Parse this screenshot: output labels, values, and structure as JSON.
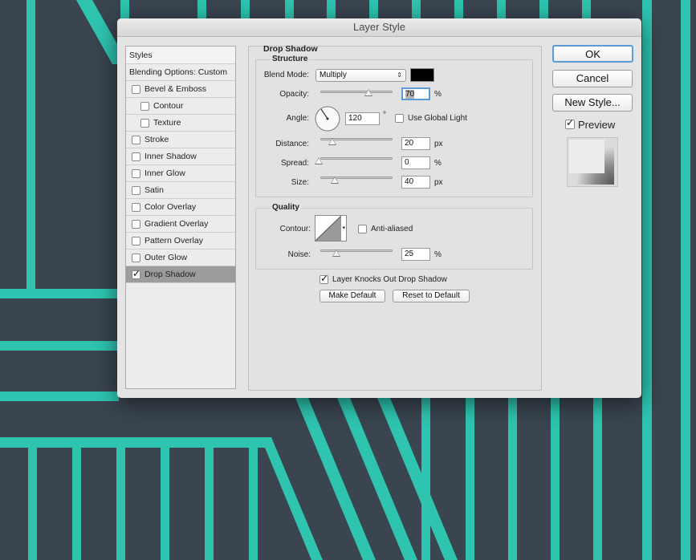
{
  "dialog": {
    "title": "Layer Style"
  },
  "styles_panel": {
    "header": "Styles",
    "blending_options": "Blending Options: Custom",
    "items": [
      {
        "label": "Bevel & Emboss",
        "checked": false,
        "sub": false
      },
      {
        "label": "Contour",
        "checked": false,
        "sub": true
      },
      {
        "label": "Texture",
        "checked": false,
        "sub": true
      },
      {
        "label": "Stroke",
        "checked": false,
        "sub": false
      },
      {
        "label": "Inner Shadow",
        "checked": false,
        "sub": false
      },
      {
        "label": "Inner Glow",
        "checked": false,
        "sub": false
      },
      {
        "label": "Satin",
        "checked": false,
        "sub": false
      },
      {
        "label": "Color Overlay",
        "checked": false,
        "sub": false
      },
      {
        "label": "Gradient Overlay",
        "checked": false,
        "sub": false
      },
      {
        "label": "Pattern Overlay",
        "checked": false,
        "sub": false
      },
      {
        "label": "Outer Glow",
        "checked": false,
        "sub": false
      },
      {
        "label": "Drop Shadow",
        "checked": true,
        "sub": false,
        "selected": true
      }
    ]
  },
  "drop_shadow": {
    "title": "Drop Shadow",
    "structure": {
      "title": "Structure",
      "blend_mode_label": "Blend Mode:",
      "blend_mode_value": "Multiply",
      "shadow_color": "#000000",
      "opacity_label": "Opacity:",
      "opacity_value": "70",
      "opacity_unit": "%",
      "angle_label": "Angle:",
      "angle_value": "120",
      "angle_unit": "°",
      "use_global_light_label": "Use Global Light",
      "use_global_light_checked": false,
      "distance_label": "Distance:",
      "distance_value": "20",
      "distance_unit": "px",
      "spread_label": "Spread:",
      "spread_value": "0",
      "spread_unit": "%",
      "size_label": "Size:",
      "size_value": "40",
      "size_unit": "px"
    },
    "quality": {
      "title": "Quality",
      "contour_label": "Contour:",
      "anti_aliased_label": "Anti-aliased",
      "anti_aliased_checked": false,
      "noise_label": "Noise:",
      "noise_value": "25",
      "noise_unit": "%"
    },
    "layer_knocks_out_label": "Layer Knocks Out Drop Shadow",
    "layer_knocks_out_checked": true,
    "make_default_label": "Make Default",
    "reset_default_label": "Reset to Default"
  },
  "actions": {
    "ok_label": "OK",
    "cancel_label": "Cancel",
    "new_style_label": "New Style...",
    "preview_label": "Preview",
    "preview_checked": true
  },
  "colors": {
    "background": "#3a4550",
    "stripe": "#2ec4b0",
    "dialog": "#e4e4e4"
  }
}
